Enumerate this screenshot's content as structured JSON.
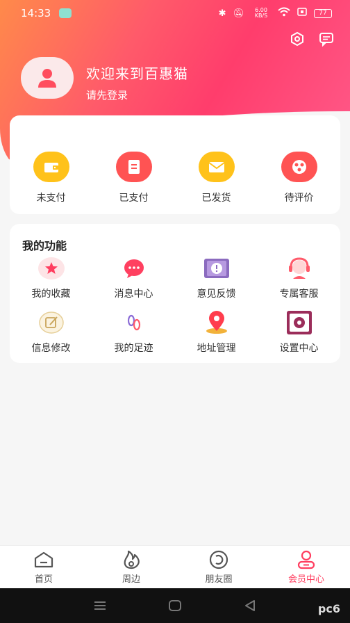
{
  "status_bar": {
    "time": "14:33",
    "net_speed": "6.00 KB/S",
    "battery": "77"
  },
  "profile": {
    "welcome": "欢迎来到百惠猫",
    "login_hint": "请先登录"
  },
  "orders": [
    {
      "label": "未支付",
      "icon": "wallet-icon",
      "color": "#ffc21a"
    },
    {
      "label": "已支付",
      "icon": "bill-icon",
      "color": "#ff5353"
    },
    {
      "label": "已发货",
      "icon": "mail-icon",
      "color": "#ffc21a"
    },
    {
      "label": "待评价",
      "icon": "review-icon",
      "color": "#ff5353"
    }
  ],
  "functions": {
    "title": "我的功能",
    "items": [
      {
        "label": "我的收藏",
        "icon": "star-icon"
      },
      {
        "label": "消息中心",
        "icon": "message-icon"
      },
      {
        "label": "意见反馈",
        "icon": "feedback-icon"
      },
      {
        "label": "专属客服",
        "icon": "customer-service-icon"
      },
      {
        "label": "信息修改",
        "icon": "edit-icon"
      },
      {
        "label": "我的足迹",
        "icon": "footprint-icon"
      },
      {
        "label": "地址管理",
        "icon": "location-icon"
      },
      {
        "label": "设置中心",
        "icon": "settings-icon"
      }
    ]
  },
  "bottom_nav": [
    {
      "label": "首页",
      "icon": "home-icon",
      "active": false
    },
    {
      "label": "周边",
      "icon": "nearby-icon",
      "active": false
    },
    {
      "label": "朋友圈",
      "icon": "moments-icon",
      "active": false
    },
    {
      "label": "会员中心",
      "icon": "member-icon",
      "active": true
    }
  ],
  "watermark": "pc6",
  "colors": {
    "accent": "#ff3d5f",
    "header_start": "#ff8a4a",
    "header_end": "#ff3d6c"
  }
}
